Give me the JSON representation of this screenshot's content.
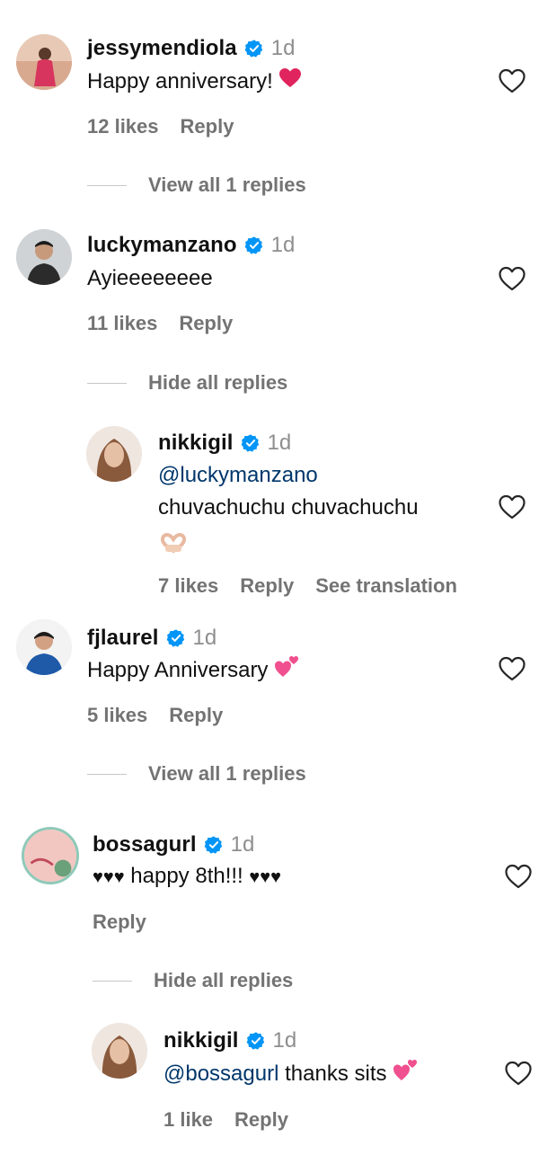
{
  "comments": [
    {
      "username": "jessymendiola",
      "time": "1d",
      "text": "Happy anniversary!",
      "likes": "12 likes",
      "reply": "Reply",
      "toggle": "View all 1 replies"
    },
    {
      "username": "luckymanzano",
      "time": "1d",
      "text": "Ayieeeeeeee",
      "likes": "11 likes",
      "reply": "Reply",
      "toggle": "Hide all replies",
      "replies": [
        {
          "username": "nikkigil",
          "time": "1d",
          "mention": "@luckymanzano",
          "text": "chuvachuchu chuvachuchu",
          "likes": "7 likes",
          "reply": "Reply",
          "translate": "See translation"
        }
      ]
    },
    {
      "username": "fjlaurel",
      "time": "1d",
      "text": "Happy Anniversary",
      "likes": "5 likes",
      "reply": "Reply",
      "toggle": "View all 1 replies"
    },
    {
      "username": "bossagurl",
      "time": "1d",
      "text_pre": "♥♥♥",
      "text": " happy 8th!!! ",
      "text_post": "♥♥♥",
      "reply": "Reply",
      "toggle": "Hide all replies",
      "replies": [
        {
          "username": "nikkigil",
          "time": "1d",
          "mention": "@bossagurl",
          "text": " thanks sits",
          "likes": "1 like",
          "reply": "Reply"
        }
      ]
    }
  ],
  "colors": {
    "verified": "#0095f6",
    "secondary_text": "#737373",
    "mention": "#00376b",
    "heart_red": "#e0245e",
    "pink": "#f0508f"
  },
  "icons": [
    "verified-badge-icon",
    "heart-outline-icon",
    "red-heart-emoji",
    "two-hearts-emoji",
    "heart-hands-emoji"
  ]
}
